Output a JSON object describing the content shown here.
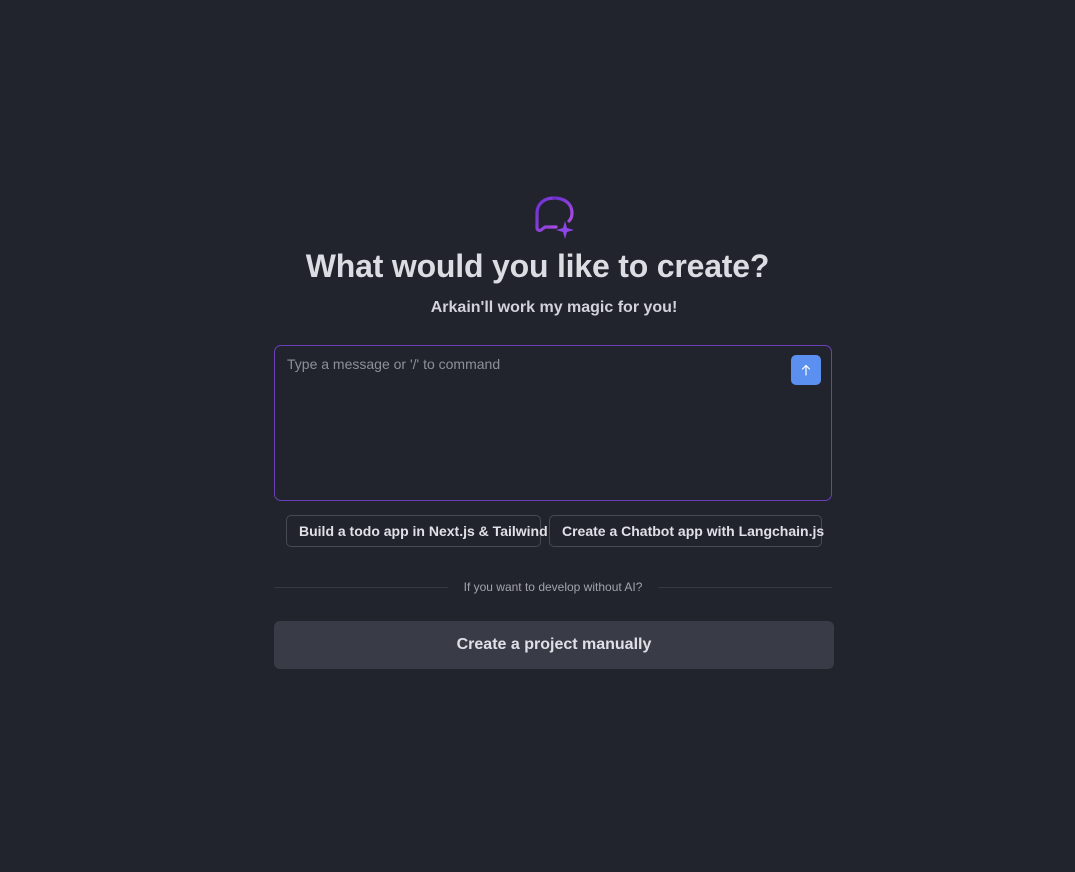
{
  "hero": {
    "icon": "chat-sparkle-icon",
    "title": "What would you like to create?",
    "subtitle": "Arkain'll work my magic for you!"
  },
  "prompt": {
    "placeholder": "Type a message or '/' to command",
    "value": "",
    "send_icon": "arrow-up-icon"
  },
  "suggestions": [
    "Build a todo app in Next.js & Tailwind",
    "Create a Chatbot app with Langchain.js"
  ],
  "divider": {
    "text": "If you want to develop without AI?"
  },
  "manual": {
    "label": "Create a project manually"
  },
  "colors": {
    "background": "#21232d",
    "accent_purple": "#7b3fe0",
    "send_button": "#5b8ff0",
    "secondary_button": "#393b46"
  }
}
